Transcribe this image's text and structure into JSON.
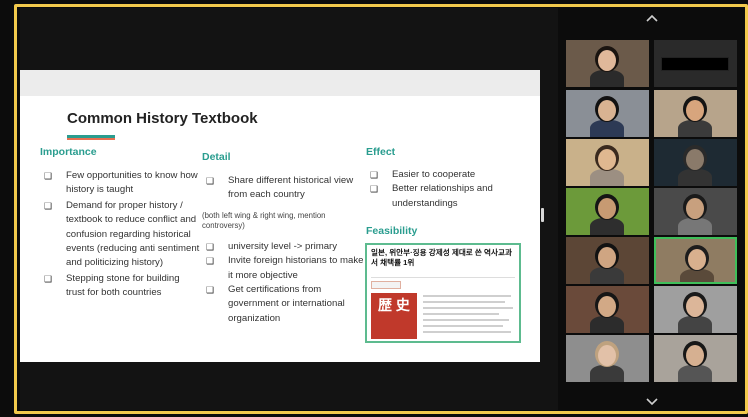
{
  "slide": {
    "title": "Common History Textbook",
    "importance": {
      "heading": "Importance",
      "items": [
        "Few opportunities to know how history is taught",
        "Demand for proper history / textbook to reduce conflict and confusion regarding historical events (reducing anti sentiment and politicizing history)",
        "Stepping stone for building trust for both countries"
      ]
    },
    "detail": {
      "heading": "Detail",
      "items_top": [
        "Share different historical view from each country"
      ],
      "note": "(both left wing & right wing, mention controversy)",
      "items_bottom": [
        "university level -> primary",
        "Invite foreign historians to make it more objective",
        "Get certifications from government or international organization"
      ]
    },
    "effect": {
      "heading": "Effect",
      "items": [
        "Easier to cooperate",
        "Better relationships and understandings"
      ]
    },
    "feasibility": {
      "heading": "Feasibility",
      "article_title": "일본, 위안부·징용 강제성 제대로 쓴 역사교과서 채택률 1위",
      "article_image_text": "歴 史"
    }
  },
  "checkbox_glyph": "❑",
  "gallery": {
    "participants": [
      {
        "label": "participant-1",
        "bg": "#6b5a4a",
        "skin": "#e0b89a",
        "hair": "#1a1410",
        "shirt": "#2b2b2b"
      },
      {
        "label": "participant-2",
        "bg": "#2a2a2a",
        "skin": "#2a2a2a",
        "hair": "#2a2a2a",
        "shirt": "#2a2a2a"
      },
      {
        "label": "participant-3",
        "bg": "#8a8f96",
        "skin": "#d9b392",
        "hair": "#111",
        "shirt": "#2d3a55"
      },
      {
        "label": "participant-4",
        "bg": "#b7a48b",
        "skin": "#d7a57d",
        "hair": "#141414",
        "shirt": "#3b3b3b"
      },
      {
        "label": "participant-5",
        "bg": "#c9b18a",
        "skin": "#e0b890",
        "hair": "#3a2a1e",
        "shirt": "#9c8f82"
      },
      {
        "label": "participant-6",
        "bg": "#1e2a33",
        "skin": "#8a7a6a",
        "hair": "#2a2a2a",
        "shirt": "#333"
      },
      {
        "label": "participant-7",
        "bg": "#6c9a3a",
        "skin": "#c79a72",
        "hair": "#151515",
        "shirt": "#2e2e2e"
      },
      {
        "label": "participant-8",
        "bg": "#4a4a4a",
        "skin": "#c8a07e",
        "hair": "#1a1a1a",
        "shirt": "#777"
      },
      {
        "label": "participant-9",
        "bg": "#5c4636",
        "skin": "#cfa582",
        "hair": "#121212",
        "shirt": "#3a3a3a"
      },
      {
        "label": "participant-10",
        "bg": "#8f7c62",
        "skin": "#d8b08e",
        "hair": "#1d1d1d",
        "shirt": "#5a4a3a"
      },
      {
        "label": "participant-11",
        "bg": "#6a4a3a",
        "skin": "#d2a986",
        "hair": "#161616",
        "shirt": "#2c2c2c"
      },
      {
        "label": "participant-12",
        "bg": "#9f9f9f",
        "skin": "#dcb699",
        "hair": "#1a1a1a",
        "shirt": "#444"
      },
      {
        "label": "participant-13",
        "bg": "#8e8e8e",
        "skin": "#e2c1a8",
        "hair": "#bfa27f",
        "shirt": "#3a3a3a"
      },
      {
        "label": "participant-14",
        "bg": "#a9a39b",
        "skin": "#d6b091",
        "hair": "#171717",
        "shirt": "#555"
      }
    ]
  },
  "colors": {
    "accent": "#2a9d8f",
    "active_border": "#3fbf5a",
    "share_border": "#f2c94c"
  }
}
